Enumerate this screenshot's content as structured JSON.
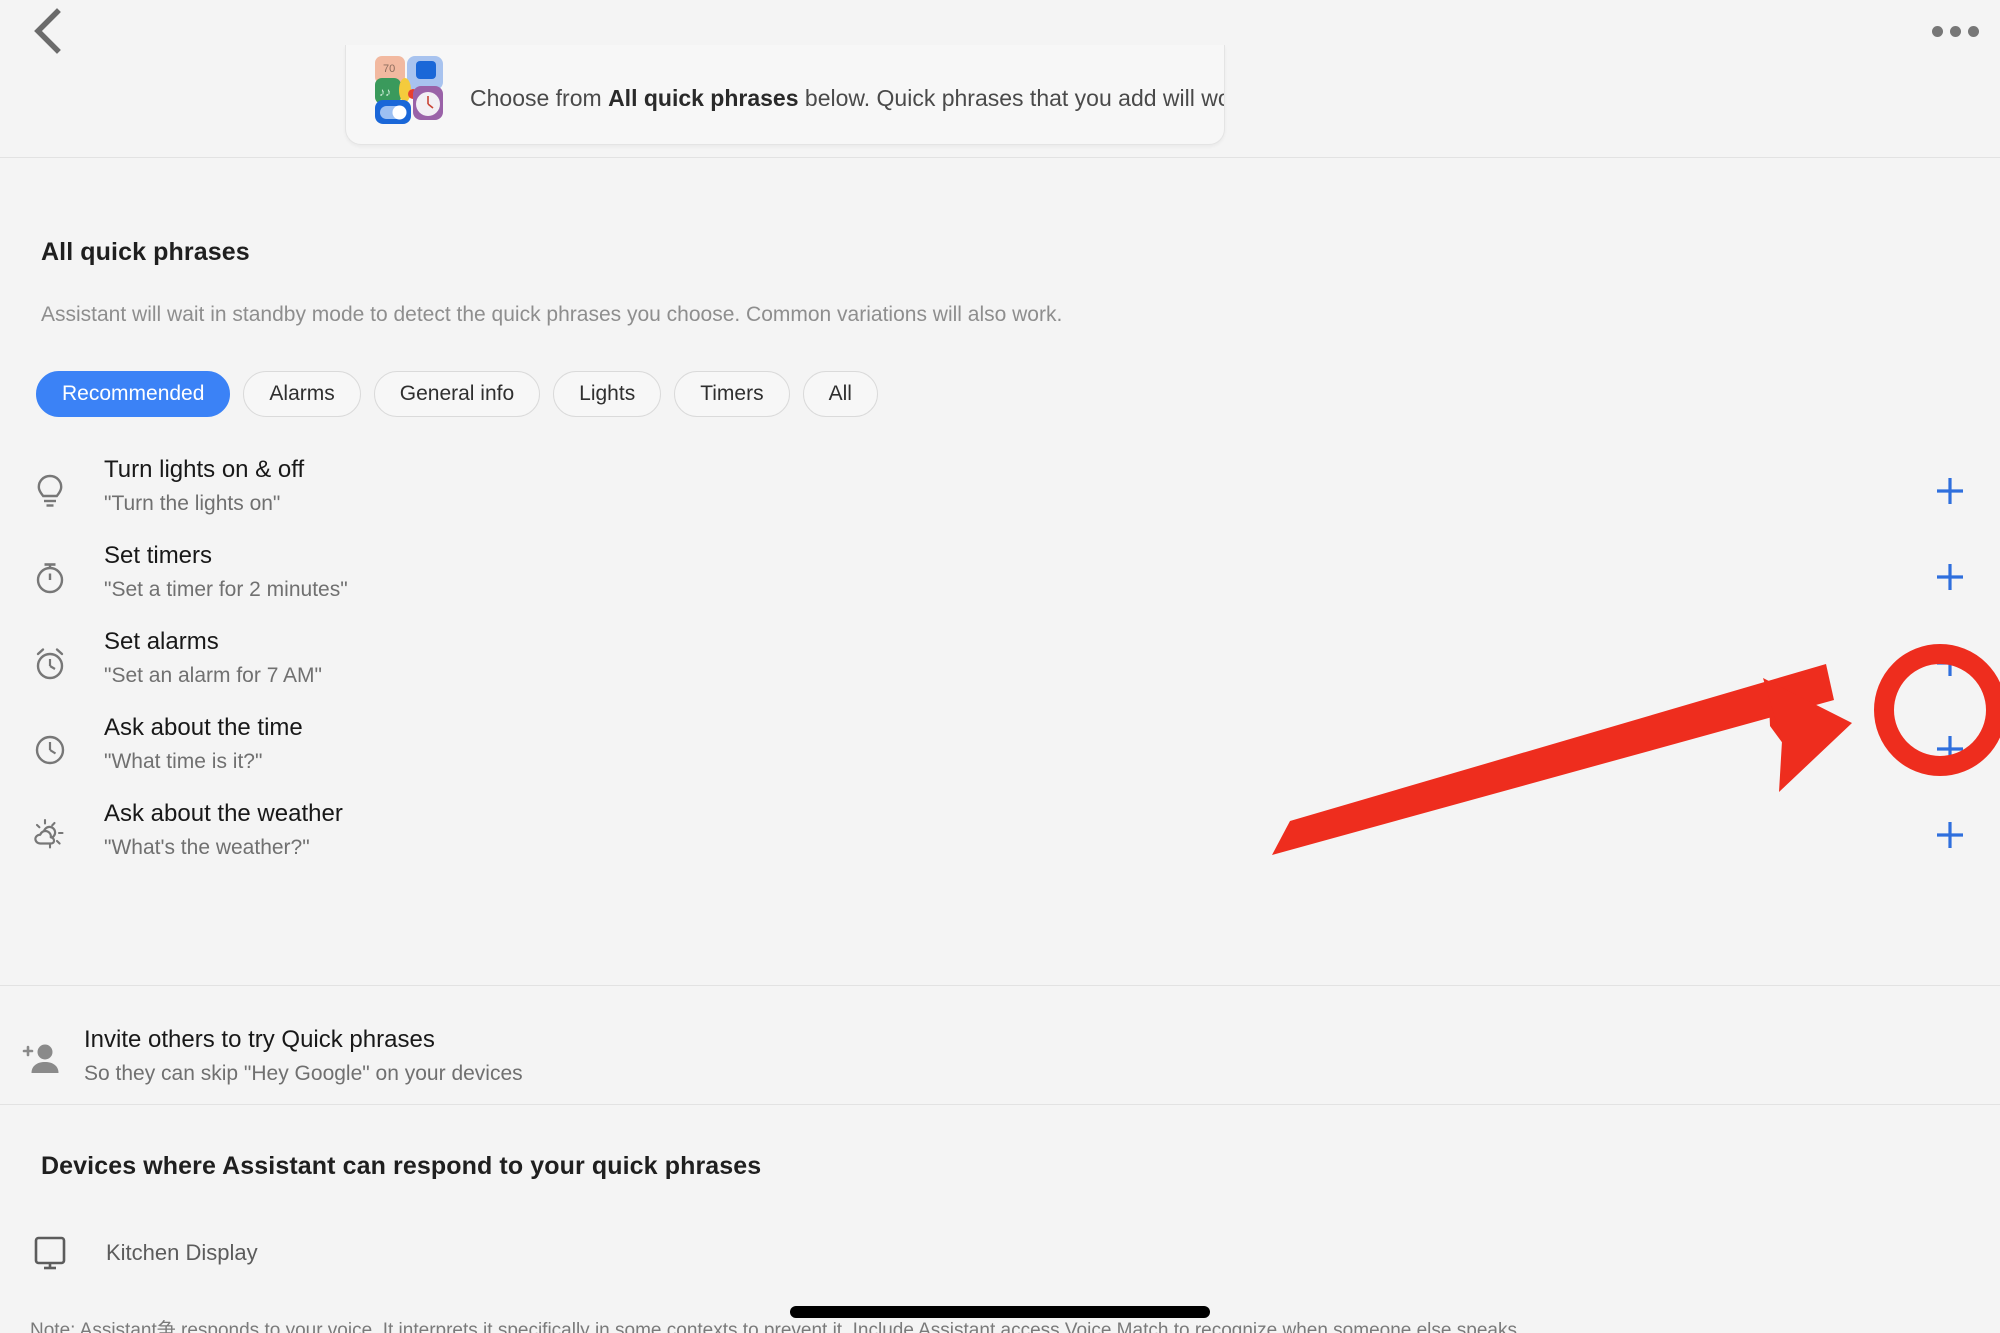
{
  "appbar": {
    "back_icon": "chevron-left-icon",
    "more_icon": "more-horizontal-icon"
  },
  "hero_card": {
    "icon": "quick-phrases-collage-icon",
    "text_before": "Choose from ",
    "text_bold": "All quick phrases",
    "text_after": " below. Quick phrases that you add will work just for you."
  },
  "all_quick_phrases": {
    "title": "All quick phrases",
    "description": "Assistant will wait in standby mode to detect the quick phrases you choose. Common variations will also work.",
    "chips": [
      {
        "label": "Recommended",
        "selected": true
      },
      {
        "label": "Alarms",
        "selected": false
      },
      {
        "label": "General info",
        "selected": false
      },
      {
        "label": "Lights",
        "selected": false
      },
      {
        "label": "Timers",
        "selected": false
      },
      {
        "label": "All",
        "selected": false
      }
    ],
    "add_label": "+",
    "rows": [
      {
        "icon": "lightbulb-icon",
        "title": "Turn lights on & off",
        "example": "\"Turn the lights on\""
      },
      {
        "icon": "timer-icon",
        "title": "Set timers",
        "example": "\"Set a timer for 2 minutes\""
      },
      {
        "icon": "alarm-clock-icon",
        "title": "Set alarms",
        "example": "\"Set an alarm for 7 AM\""
      },
      {
        "icon": "clock-icon",
        "title": "Ask about the time",
        "example": "\"What time is it?\""
      },
      {
        "icon": "partly-cloudy-icon",
        "title": "Ask about the weather",
        "example": "\"What's the weather?\""
      }
    ]
  },
  "invite": {
    "icon": "person-add-icon",
    "title": "Invite others to try Quick phrases",
    "subtitle": "So they can skip \"Hey Google\" on your devices"
  },
  "devices": {
    "title": "Devices where Assistant can respond to your quick phrases",
    "items": [
      {
        "icon": "display-icon",
        "label": "Kitchen Display"
      }
    ]
  },
  "footnote": {
    "text": "Note: Assistant争 responds to your voice. It interprets it specifically in some contexts to prevent it. Include Assistant access Voice Match to recognize when someone else speaks."
  },
  "annotation": {
    "color": "#ee2d1e",
    "arrow": "red-arrow",
    "highlight": "red-circle-highlight",
    "target_row": "Set alarms"
  },
  "colors": {
    "accent_blue": "#2f6fdd",
    "chip_selected": "#3b82f6",
    "background": "#f4f4f4",
    "annotation_red": "#ee2d1e"
  }
}
